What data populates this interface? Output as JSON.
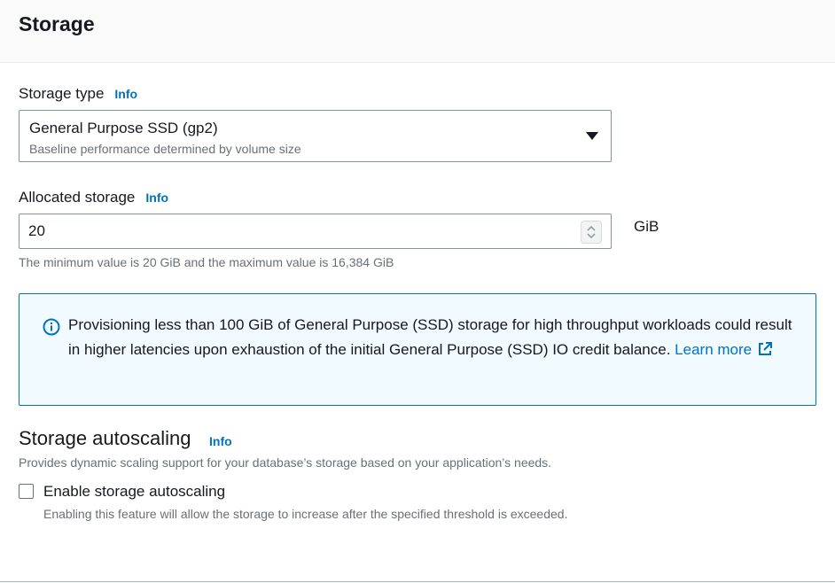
{
  "section": {
    "title": "Storage"
  },
  "storage_type": {
    "label": "Storage type",
    "info": "Info",
    "selected": "General Purpose SSD (gp2)",
    "selected_description": "Baseline performance determined by volume size"
  },
  "allocated_storage": {
    "label": "Allocated storage",
    "info": "Info",
    "value": "20",
    "unit": "GiB",
    "hint": "The minimum value is 20 GiB and the maximum value is 16,384 GiB"
  },
  "alert": {
    "message": "Provisioning less than 100 GiB of General Purpose (SSD) storage for high throughput workloads could result in higher latencies upon exhaustion of the initial General Purpose (SSD) IO credit balance. ",
    "link_text": "Learn more",
    "icon": "info-circle-icon",
    "link_icon": "external-link-icon"
  },
  "autoscaling": {
    "title": "Storage autoscaling",
    "info": "Info",
    "description": "Provides dynamic scaling support for your database’s storage based on your application’s needs.",
    "checkbox_label": "Enable storage autoscaling",
    "checkbox_checked": false,
    "checkbox_description": "Enabling this feature will allow the storage to increase after the specified threshold is exceeded."
  },
  "colors": {
    "link": "#0073bb",
    "alert_bg": "#f1faff",
    "border": "#879596",
    "secondary_text": "#687078"
  }
}
